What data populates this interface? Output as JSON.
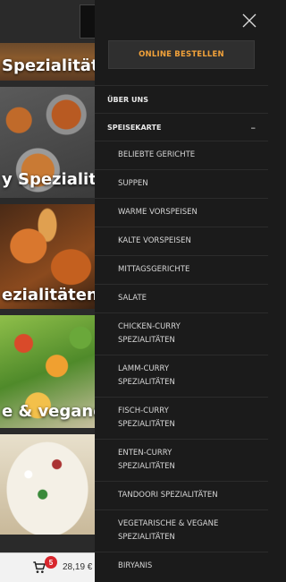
{
  "background_page": {
    "categories": [
      "Spezialitäten",
      "y Spezialitäten",
      "ezialitäten",
      "e & vegane Spe"
    ],
    "cart": {
      "count": "5",
      "total": "28,19 €"
    }
  },
  "drawer": {
    "order_button": "ONLINE BESTELLEN",
    "about": "ÜBER UNS",
    "menu_label": "SPEISEKARTE",
    "collapse_symbol": "–",
    "menu_items": [
      {
        "label": "BELIEBTE GERICHTE"
      },
      {
        "label": "SUPPEN"
      },
      {
        "label": "WARME VORSPEISEN"
      },
      {
        "label": "KALTE VORSPEISEN"
      },
      {
        "label": "MITTAGSGERICHTE"
      },
      {
        "label": "SALATE"
      },
      {
        "line1": "CHICKEN-CURRY",
        "line2": "SPEZIALITÄTEN"
      },
      {
        "line1": "LAMM-CURRY",
        "line2": "SPEZIALITÄTEN"
      },
      {
        "line1": "FISCH-CURRY",
        "line2": "SPEZIALITÄTEN"
      },
      {
        "line1": "ENTEN-CURRY",
        "line2": "SPEZIALITÄTEN"
      },
      {
        "label": "TANDOORI SPEZIALITÄTEN"
      },
      {
        "line1": "VEGETARISCHE & VEGANE",
        "line2": "SPEZIALITÄTEN"
      },
      {
        "label": "BIRYANIS"
      }
    ]
  },
  "colors": {
    "drawer_bg": "#1b1b1b",
    "accent_orange": "#f2a23a",
    "badge_red": "#d8262d"
  },
  "icons": [
    "close-icon",
    "cart-icon"
  ]
}
